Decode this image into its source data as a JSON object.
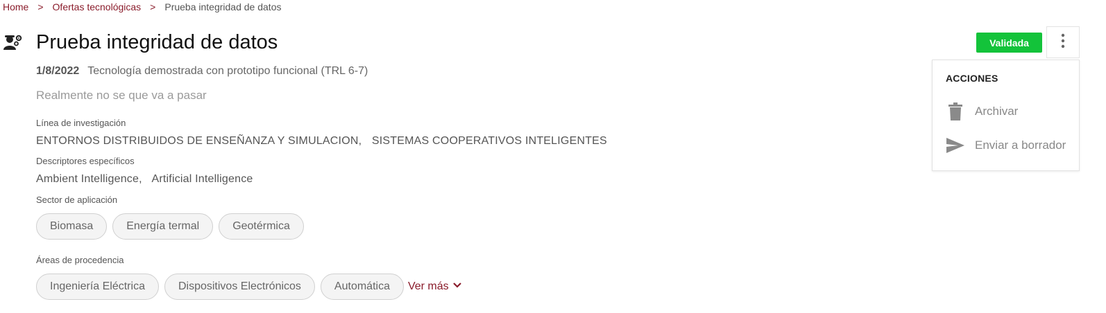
{
  "breadcrumb": {
    "items": [
      "Home",
      "Ofertas tecnológicas"
    ],
    "separator": ">",
    "current": "Prueba integridad de datos"
  },
  "header": {
    "icon": "researchers-gear-icon",
    "title": "Prueba integridad de datos",
    "date": "1/8/2022",
    "trl": "Tecnología demostrada con prototipo funcional (TRL 6-7)",
    "subtitle": "Realmente no se que va a pasar",
    "status": "Validada",
    "status_color": "#13c33a"
  },
  "sections": {
    "research_line": {
      "label": "Línea de investigación",
      "values": [
        "ENTORNOS DISTRIBUIDOS DE ENSEÑANZA Y SIMULACION,",
        "SISTEMAS COOPERATIVOS INTELIGENTES"
      ]
    },
    "descriptors": {
      "label": "Descriptores específicos",
      "values": [
        "Ambient Intelligence,",
        "Artificial Intelligence"
      ]
    },
    "sector": {
      "label": "Sector de aplicación",
      "chips": [
        "Biomasa",
        "Energía termal",
        "Geotérmica"
      ]
    },
    "areas": {
      "label": "Áreas de procedencia",
      "chips": [
        "Ingeniería Eléctrica",
        "Dispositivos Electrónicos",
        "Automática"
      ],
      "more": "Ver más"
    }
  },
  "actions_menu": {
    "title": "ACCIONES",
    "items": [
      {
        "label": "Archivar",
        "icon": "trash-icon"
      },
      {
        "label": "Enviar a borrador",
        "icon": "send-icon"
      }
    ]
  },
  "colors": {
    "accent": "#8a1c2b",
    "muted": "#888888"
  }
}
